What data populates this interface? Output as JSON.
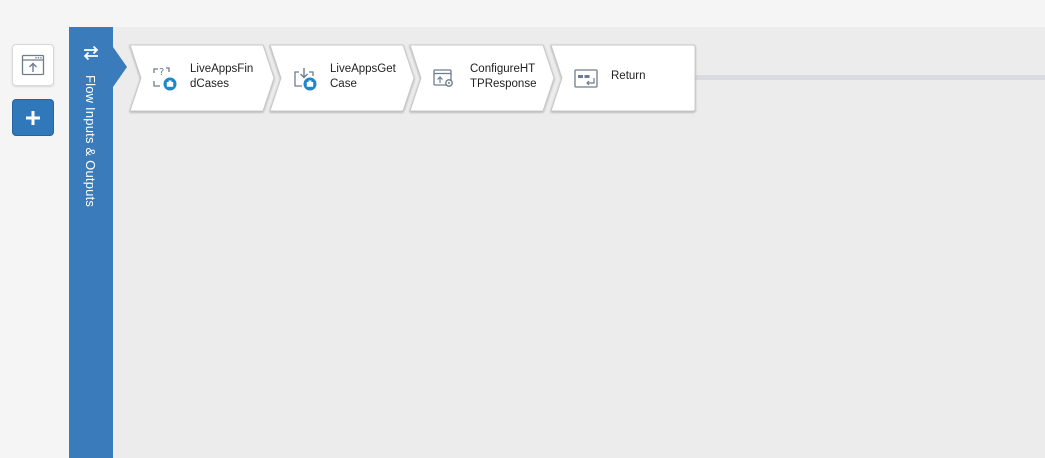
{
  "left_rail": {
    "trigger_icon": "browser-upload-icon",
    "add_icon": "plus-icon",
    "add_label": "+"
  },
  "io_bar": {
    "label": "Flow Inputs & Outputs",
    "icon": "swap-arrows-icon"
  },
  "steps": [
    {
      "line1": "LiveAppsFin",
      "line2": "dCases",
      "icon": "find-cases-icon"
    },
    {
      "line1": "LiveAppsGet",
      "line2": "Case",
      "icon": "get-case-icon"
    },
    {
      "line1": "ConfigureHT",
      "line2": "TPResponse",
      "icon": "configure-response-icon"
    },
    {
      "line1": "Return",
      "line2": "",
      "icon": "return-icon"
    }
  ],
  "colors": {
    "accent_blue": "#3a7bbc",
    "canvas": "#edecec",
    "icon_badge": "#1f86c9"
  }
}
